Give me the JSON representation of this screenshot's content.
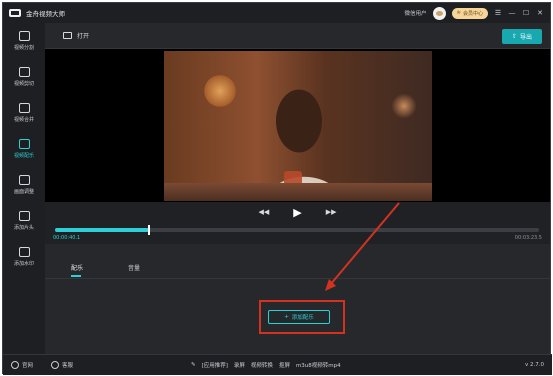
{
  "app": {
    "title": "金舟视频大师"
  },
  "titlebar": {
    "user": "微信用户",
    "vip": "会员中心",
    "menu_glyph": "☰",
    "min_glyph": "—",
    "max_glyph": "☐",
    "close_glyph": "✕"
  },
  "sidebar": {
    "items": [
      {
        "label": "视频分割",
        "icon": "split-icon"
      },
      {
        "label": "视频剪切",
        "icon": "scissors-icon"
      },
      {
        "label": "视频合并",
        "icon": "merge-icon"
      },
      {
        "label": "视频配乐",
        "icon": "music-icon",
        "active": true
      },
      {
        "label": "画面调整",
        "icon": "crop-icon"
      },
      {
        "label": "添加片头",
        "icon": "intro-icon"
      },
      {
        "label": "添加水印",
        "icon": "watermark-icon"
      }
    ]
  },
  "toolbar": {
    "open_label": "打开",
    "export_label": "导出",
    "export_glyph": "⇧"
  },
  "player": {
    "rewind_glyph": "◀◀",
    "play_glyph": "▶",
    "forward_glyph": "▶▶",
    "current_time": "00:00:40.1",
    "total_time": "00:03:23.5",
    "progress": 0.195
  },
  "tabs": [
    {
      "label": "配乐",
      "active": true
    },
    {
      "label": "音量",
      "active": false
    }
  ],
  "add_music": {
    "label": "添加配乐",
    "glyph": "+"
  },
  "statusbar": {
    "website": "官网",
    "support": "客服",
    "recommend": "[应用推荐]",
    "links": [
      "录屏",
      "视频转换",
      "抠屏",
      "m3u8视频转mp4"
    ],
    "version": "v 2.7.0"
  },
  "colors": {
    "accent": "#2ecfd6",
    "export_bg": "#18a9b0",
    "annotation": "#d2321f"
  }
}
